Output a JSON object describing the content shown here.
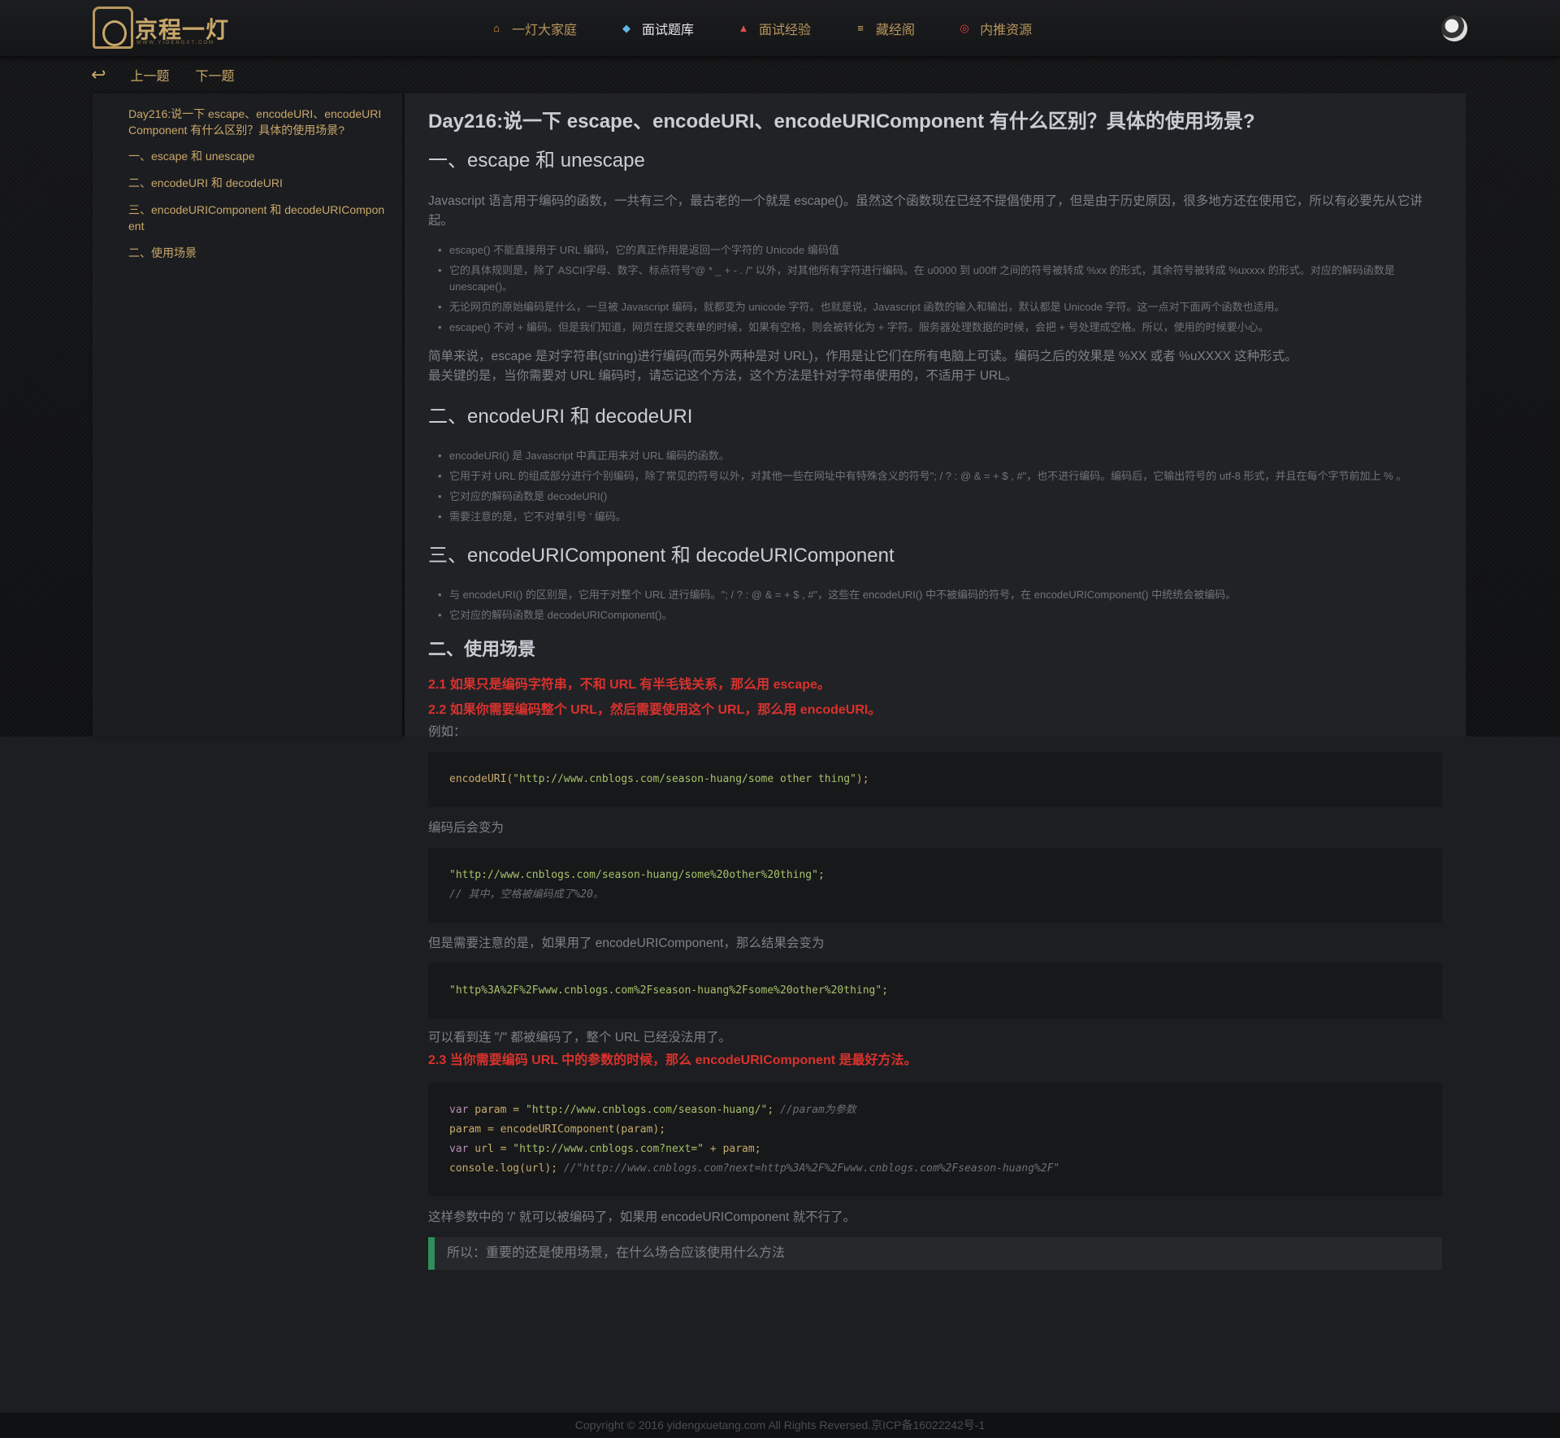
{
  "brand": {
    "logo_text": "京程一灯",
    "logo_sub": "WWW.YIDENGXT.COM"
  },
  "nav": [
    {
      "label": "一灯大家庭",
      "icon": "home-icon",
      "glyph": "⌂",
      "color": "#e5a03a"
    },
    {
      "label": "面试题库",
      "icon": "diamond-icon",
      "glyph": "◆",
      "color": "#5fb8e8",
      "active": true
    },
    {
      "label": "面试经验",
      "icon": "chart-icon",
      "glyph": "▲",
      "color": "#e05050"
    },
    {
      "label": "藏经阁",
      "icon": "books-icon",
      "glyph": "≡",
      "color": "#d8b060"
    },
    {
      "label": "内推资源",
      "icon": "target-icon",
      "glyph": "◎",
      "color": "#e04040"
    }
  ],
  "subbar": {
    "prev": "上一题",
    "next": "下一题"
  },
  "toc": [
    "Day216:说一下 escape、encodeURI、encodeURIComponent 有什么区别？具体的使用场景?",
    "一、escape 和 unescape",
    "二、encodeURI 和 decodeURI",
    "三、encodeURIComponent 和 decodeURIComponent",
    "二、使用场景"
  ],
  "article": {
    "title": "Day216:说一下 escape、encodeURI、encodeURIComponent 有什么区别？具体的使用场景?",
    "s1": {
      "heading": "一、escape 和 unescape",
      "intro": "Javascript 语言用于编码的函数，一共有三个，最古老的一个就是 escape()。虽然这个函数现在已经不提倡使用了，但是由于历史原因，很多地方还在使用它，所以有必要先从它讲起。",
      "bullets": [
        "escape() 不能直接用于 URL 编码，它的真正作用是返回一个字符的 Unicode 编码值",
        "它的具体规则是，除了 ASCII字母、数字、标点符号\"@ * _ + - . /\" 以外，对其他所有字符进行编码。在 u0000 到 u00ff 之间的符号被转成 %xx 的形式，其余符号被转成 %uxxxx 的形式。对应的解码函数是 unescape()。",
        "无论网页的原始编码是什么，一旦被 Javascript 编码，就都变为 unicode 字符。也就是说，Javascript 函数的输入和输出，默认都是 Unicode 字符。这一点对下面两个函数也适用。",
        "escape() 不对 + 编码。但是我们知道，网页在提交表单的时候，如果有空格，则会被转化为 + 字符。服务器处理数据的时候，会把 + 号处理成空格。所以，使用的时候要小心。"
      ],
      "p1": "简单来说，escape 是对字符串(string)进行编码(而另外两种是对 URL)，作用是让它们在所有电脑上可读。编码之后的效果是 %XX 或者 %uXXXX 这种形式。",
      "p2": "最关键的是，当你需要对 URL 编码时，请忘记这个方法，这个方法是针对字符串使用的，不适用于 URL。"
    },
    "s2": {
      "heading": "二、encodeURI 和 decodeURI",
      "bullets": [
        "encodeURI() 是 Javascript 中真正用来对 URL 编码的函数。",
        "它用于对 URL 的组成部分进行个别编码，除了常见的符号以外，对其他一些在网址中有特殊含义的符号\"; / ? : @ & = + $ , #\"，也不进行编码。编码后，它输出符号的 utf-8 形式，并且在每个字节前加上 % 。",
        "它对应的解码函数是 decodeURI()",
        "需要注意的是，它不对单引号 ' 编码。"
      ]
    },
    "s3": {
      "heading": "三、encodeURIComponent 和 decodeURIComponent",
      "bullets": [
        "与 encodeURI() 的区别是，它用于对整个 URL 进行编码。\"; / ? : @ & = + $ , #\"，这些在 encodeURI() 中不被编码的符号，在 encodeURIComponent() 中统统会被编码。",
        "它对应的解码函数是 decodeURIComponent()。"
      ]
    },
    "s4": {
      "heading": "二、使用场景",
      "r1": "2.1 如果只是编码字符串，不和 URL 有半毛钱关系，那么用 escape。",
      "r2": "2.2 如果你需要编码整个 URL，然后需要使用这个 URL，那么用 encodeURI。",
      "example_label": "例如：",
      "code1_fn": "encodeURI",
      "code1_str": "\"http://www.cnblogs.com/season-huang/some other thing\"",
      "after_label": "编码后会变为",
      "code2_str": "\"http://www.cnblogs.com/season-huang/some%20other%20thing\";",
      "code2_comment": "// 其中，空格被编码成了%20。",
      "note1": "但是需要注意的是，如果用了 encodeURIComponent，那么结果会变为",
      "code3_str": "\"http%3A%2F%2Fwww.cnblogs.com%2Fseason-huang%2Fsome%20other%20thing\";",
      "note2": "可以看到连 \"/\" 都被编码了，整个 URL 已经没法用了。",
      "r3": "2.3 当你需要编码 URL 中的参数的时候，那么 encodeURIComponent 是最好方法。",
      "code4": {
        "l1_var": "var",
        "l1_rest": " param = ",
        "l1_str": "\"http://www.cnblogs.com/season-huang/\"",
        "l1_cmt": "//param为参数",
        "l2": "param = encodeURIComponent(param);",
        "l3_var": "var",
        "l3_rest": " url = ",
        "l3_str": "\"http://www.cnblogs.com?next=\"",
        "l3_tail": " + param;",
        "l4": "console.log(url); ",
        "l4_cmt": "//\"http://www.cnblogs.com?next=http%3A%2F%2Fwww.cnblogs.com%2Fseason-huang%2F\""
      },
      "note3": "这样参数中的 '/' 就可以被编码了，如果用 encodeURIComponent 就不行了。",
      "quote": "所以：重要的还是使用场景，在什么场合应该使用什么方法"
    }
  },
  "footer": "Copyright © 2016 yidengxuetang.com All Rights Reversed.京ICP备16022242号-1"
}
